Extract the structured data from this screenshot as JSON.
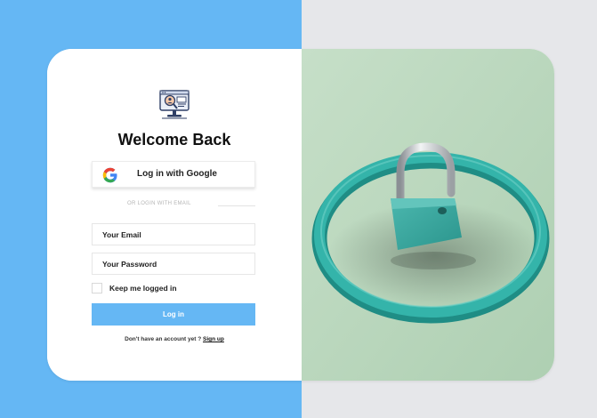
{
  "colors": {
    "left_background": "#65b7f4",
    "right_background": "#e6e7ea",
    "primary_button": "#65b7f4",
    "photo_background": "#c3dcc5",
    "ring": "#2aa79d",
    "lock_body": "#3aa8a0"
  },
  "logo": {
    "icon": "monitor-search-icon"
  },
  "login": {
    "title": "Welcome Back",
    "google_button_label": "Log in with Google",
    "google_icon": "google-g-icon",
    "divider_text": "OR LOGIN WITH EMAIL",
    "email_placeholder": "Your Email",
    "password_placeholder": "Your Password",
    "remember_label": "Keep me logged in",
    "login_button_label": "Log in",
    "signup_prompt": "Don't have an account yet ? ",
    "signup_link": "Sign up"
  },
  "image": {
    "subject": "padlock-ring-image"
  }
}
